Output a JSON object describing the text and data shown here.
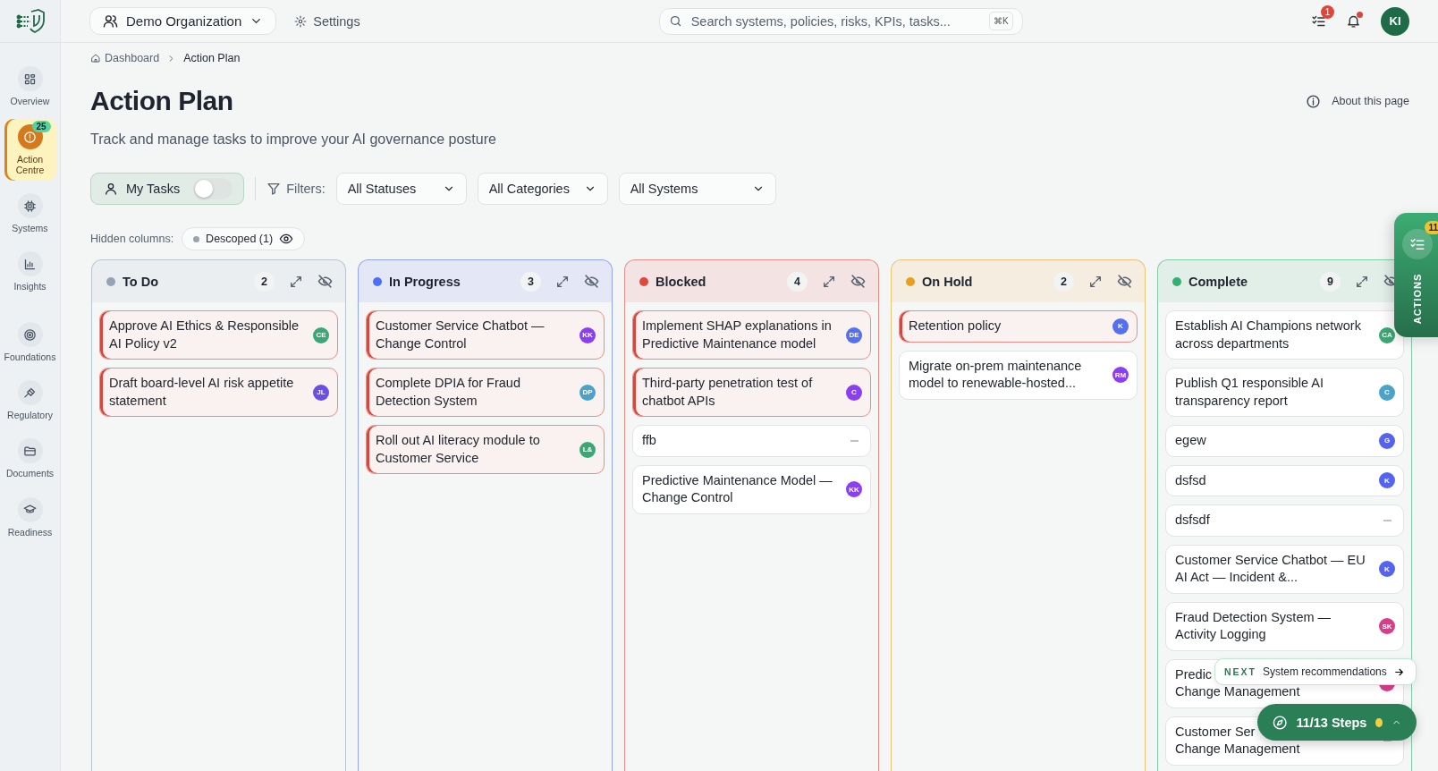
{
  "org_selector": {
    "label": "Demo Organization"
  },
  "settings_link": {
    "label": "Settings"
  },
  "search": {
    "placeholder": "Search systems, policies, risks, KPIs, tasks...",
    "shortcut": "⌘K"
  },
  "header_actions": {
    "tasks_badge": "1",
    "notification_dot": true,
    "avatar": "KI"
  },
  "sidebar": {
    "items": [
      {
        "label": "Overview",
        "selected": false
      },
      {
        "label": "Action Centre",
        "selected": true,
        "badge": "25"
      },
      {
        "label": "Systems",
        "selected": false
      },
      {
        "label": "Insights",
        "selected": false
      },
      {
        "label": "Foundations",
        "selected": false
      },
      {
        "label": "Regulatory",
        "selected": false
      },
      {
        "label": "Documents",
        "selected": false
      },
      {
        "label": "Readiness",
        "selected": false
      }
    ]
  },
  "breadcrumb": [
    "Dashboard",
    "Action Plan"
  ],
  "page": {
    "title": "Action Plan",
    "subtitle": "Track and manage tasks to improve your AI governance posture",
    "about": "About this page"
  },
  "filters": {
    "my_tasks": {
      "label": "My Tasks",
      "on": false
    },
    "label": "Filters:",
    "dropdowns": [
      "All Statuses",
      "All Categories",
      "All Systems"
    ]
  },
  "hidden_columns": {
    "label": "Hidden columns:",
    "chips": [
      {
        "label": "Descoped (1)",
        "color": "#9ca3af"
      }
    ]
  },
  "columns": [
    {
      "title": "To Do",
      "count": "2",
      "color": "#94a3b8",
      "cards": [
        {
          "kind": "urgent",
          "lines": [
            "Approve AI Ethics & Responsible",
            "AI Policy v2"
          ],
          "assignee": {
            "initials": "CE",
            "color": "#3aa874"
          }
        },
        {
          "kind": "urgent",
          "lines": [
            "Draft board-level AI risk appetite",
            "statement"
          ],
          "assignee": {
            "initials": "JL",
            "color": "#6b4fe0"
          }
        }
      ]
    },
    {
      "title": "In Progress",
      "count": "3",
      "color": "#4f6ef7",
      "cards": [
        {
          "kind": "urgent",
          "lines": [
            "Customer Service Chatbot —",
            "Change Control"
          ],
          "assignee": {
            "initials": "KK",
            "color": "#8b3ff0"
          }
        },
        {
          "kind": "urgent",
          "lines": [
            "Complete DPIA for Fraud",
            "Detection System"
          ],
          "assignee": {
            "initials": "DP",
            "color": "#4aa3c8"
          }
        },
        {
          "kind": "urgent",
          "lines": [
            "Roll out AI literacy module to",
            "Customer Service"
          ],
          "assignee": {
            "initials": "L&",
            "color": "#3aa874"
          }
        }
      ]
    },
    {
      "title": "Blocked",
      "count": "4",
      "color": "#e0483e",
      "cards": [
        {
          "kind": "urgent",
          "lines": [
            "Implement SHAP explanations in",
            "Predictive Maintenance model"
          ],
          "assignee": {
            "initials": "DE",
            "color": "#5470f0"
          }
        },
        {
          "kind": "urgent",
          "lines": [
            "Third-party penetration test of",
            "chatbot APIs"
          ],
          "assignee": {
            "initials": "C",
            "color": "#8b3ff0"
          }
        },
        {
          "kind": "normal",
          "lines": [
            "ffb"
          ]
        },
        {
          "kind": "normal",
          "lines": [
            "Predictive Maintenance Model —",
            "Change Control"
          ],
          "assignee": {
            "initials": "KK",
            "color": "#8b3ff0"
          }
        }
      ]
    },
    {
      "title": "On Hold",
      "count": "2",
      "color": "#e8a020",
      "cards": [
        {
          "kind": "urgent",
          "lines": [
            "Retention policy"
          ],
          "assignee": {
            "initials": "K",
            "color": "#5470f0"
          }
        },
        {
          "kind": "normal",
          "lines": [
            "Migrate on-prem maintenance",
            "model to renewable-hosted..."
          ],
          "assignee": {
            "initials": "RM",
            "color": "#8b3ff0"
          }
        }
      ]
    },
    {
      "title": "Complete",
      "count": "9",
      "color": "#34b070",
      "cards": [
        {
          "kind": "normal",
          "lines": [
            "Establish AI Champions network",
            "across departments"
          ],
          "assignee": {
            "initials": "CA",
            "color": "#3aa874"
          }
        },
        {
          "kind": "normal",
          "lines": [
            "Publish Q1 responsible AI",
            "transparency report"
          ],
          "assignee": {
            "initials": "C",
            "color": "#4aa3c8"
          }
        },
        {
          "kind": "normal",
          "lines": [
            "egew"
          ],
          "assignee": {
            "initials": "G",
            "color": "#5464ee"
          }
        },
        {
          "kind": "normal",
          "lines": [
            "dsfsd"
          ],
          "assignee": {
            "initials": "K",
            "color": "#5464ee"
          }
        },
        {
          "kind": "normal",
          "lines": [
            "dsfsdf"
          ]
        },
        {
          "kind": "normal",
          "lines": [
            "Customer Service Chatbot — EU",
            "AI Act — Incident &..."
          ],
          "assignee": {
            "initials": "K",
            "color": "#5464ee"
          }
        },
        {
          "kind": "normal",
          "lines": [
            "Fraud Detection System —",
            "Activity Logging"
          ],
          "assignee": {
            "initials": "SK",
            "color": "#d83d8a"
          }
        },
        {
          "kind": "covered",
          "lines": [
            "Predic",
            "Change Management"
          ],
          "assignee": {
            "color": "#d83d8a"
          }
        },
        {
          "kind": "covered",
          "lines": [
            "Customer Ser",
            "Change Management"
          ]
        }
      ]
    }
  ],
  "actions_tab": {
    "label": "ACTIONS",
    "badge": "11"
  },
  "next_hint": {
    "tag": "NEXT",
    "label": "System recommendations"
  },
  "steps_pill": {
    "label": "11/13 Steps"
  }
}
